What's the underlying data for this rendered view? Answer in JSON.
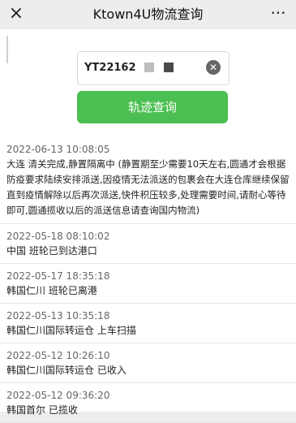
{
  "header": {
    "title": "Ktown4U物流查询",
    "close_icon": "×",
    "more_icon": "···"
  },
  "search": {
    "value": "YT22162",
    "clear_icon": "✕",
    "button_label": "轨迹查询"
  },
  "events": [
    {
      "time": "2022-06-13 10:08:05",
      "desc": "大连  清关完成,静置隔离中 (静置期至少需要10天左右,圆通才会根据防疫要求陆续安排派送,因疫情无法派送的包裹会在大连仓库继续保留直到疫情解除以后再次派送,快件积压较多,处理需要时间,请耐心等待即可,圆通揽收以后的派送信息请查询国内物流)"
    },
    {
      "time": "2022-05-18 08:10:02",
      "desc": "中国  班轮已到达港口"
    },
    {
      "time": "2022-05-17 18:35:18",
      "desc": "韩国仁川  班轮已离港"
    },
    {
      "time": "2022-05-13 10:35:18",
      "desc": "韩国仁川国际转运仓  上车扫描"
    },
    {
      "time": "2022-05-12 10:26:10",
      "desc": "韩国仁川国际转运仓  已收入"
    },
    {
      "time": "2022-05-12 09:36:20",
      "desc": "韩国首尔  已揽收"
    }
  ]
}
